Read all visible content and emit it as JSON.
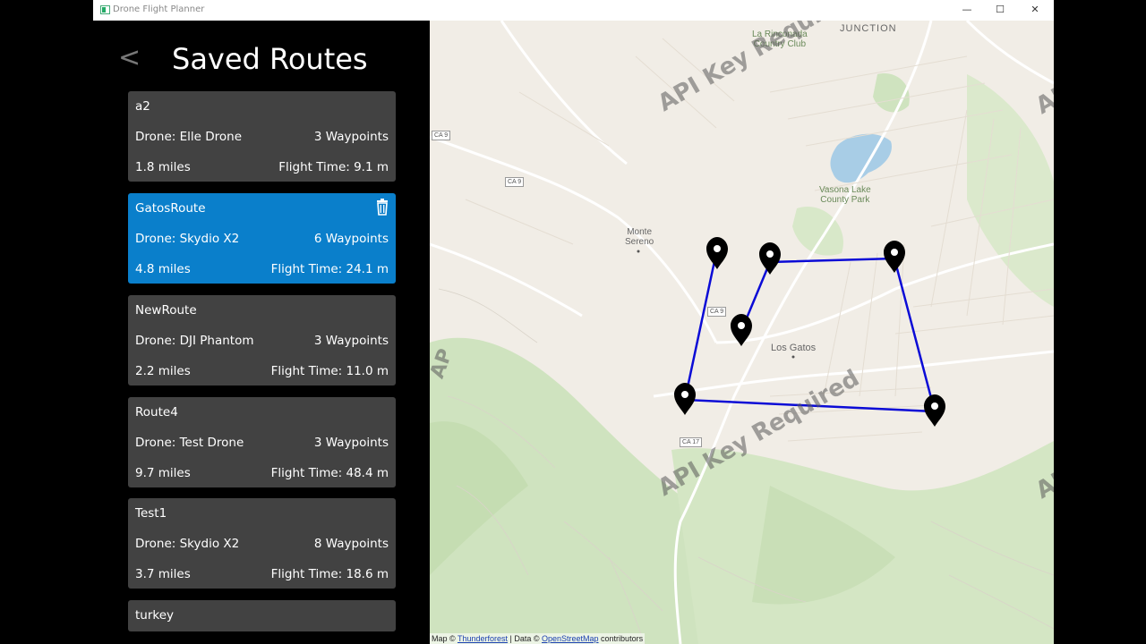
{
  "window": {
    "title": "Drone Flight Planner",
    "minimize": "—",
    "maximize": "☐",
    "close": "✕"
  },
  "sidebar": {
    "back_label": "<",
    "title": "Saved Routes",
    "routes": [
      {
        "name": "a2",
        "drone": "Drone: Elle Drone",
        "waypoints": "3 Waypoints",
        "distance": "1.8 miles",
        "flight_time": "Flight Time: 9.1 m",
        "selected": false
      },
      {
        "name": "GatosRoute",
        "drone": "Drone: Skydio X2",
        "waypoints": "6 Waypoints",
        "distance": "4.8 miles",
        "flight_time": "Flight Time: 24.1 m",
        "selected": true
      },
      {
        "name": "NewRoute",
        "drone": "Drone: DJI Phantom",
        "waypoints": "3 Waypoints",
        "distance": "2.2 miles",
        "flight_time": "Flight Time: 11.0 m",
        "selected": false
      },
      {
        "name": "Route4",
        "drone": "Drone: Test Drone",
        "waypoints": "3 Waypoints",
        "distance": "9.7 miles",
        "flight_time": "Flight Time: 48.4 m",
        "selected": false
      },
      {
        "name": "Test1",
        "drone": "Drone: Skydio X2",
        "waypoints": "8 Waypoints",
        "distance": "3.7 miles",
        "flight_time": "Flight Time: 18.6 m",
        "selected": false
      },
      {
        "name": "turkey",
        "drone": "",
        "waypoints": "",
        "distance": "",
        "flight_time": "",
        "selected": false
      }
    ]
  },
  "map": {
    "watermark": "API Key Required",
    "watermark_partial": "AP",
    "labels": {
      "junction": "JUNCTION",
      "rinconada": "La Rinconada\nCountry Club",
      "vasona": "Vasona Lake\nCounty Park",
      "monte_sereno": "Monte\nSereno",
      "los_gatos": "Los Gatos"
    },
    "shields": [
      "CA 9",
      "CA 9",
      "CA 9",
      "CA 17"
    ],
    "attribution": {
      "prefix": "Map © ",
      "provider": "Thunderforest",
      "middle": " | Data © ",
      "data_source": "OpenStreetMap",
      "suffix": " contributors"
    },
    "route_color": "#0b0bd6",
    "park_color": "#cfe3bf",
    "water_color": "#a8cde6"
  }
}
